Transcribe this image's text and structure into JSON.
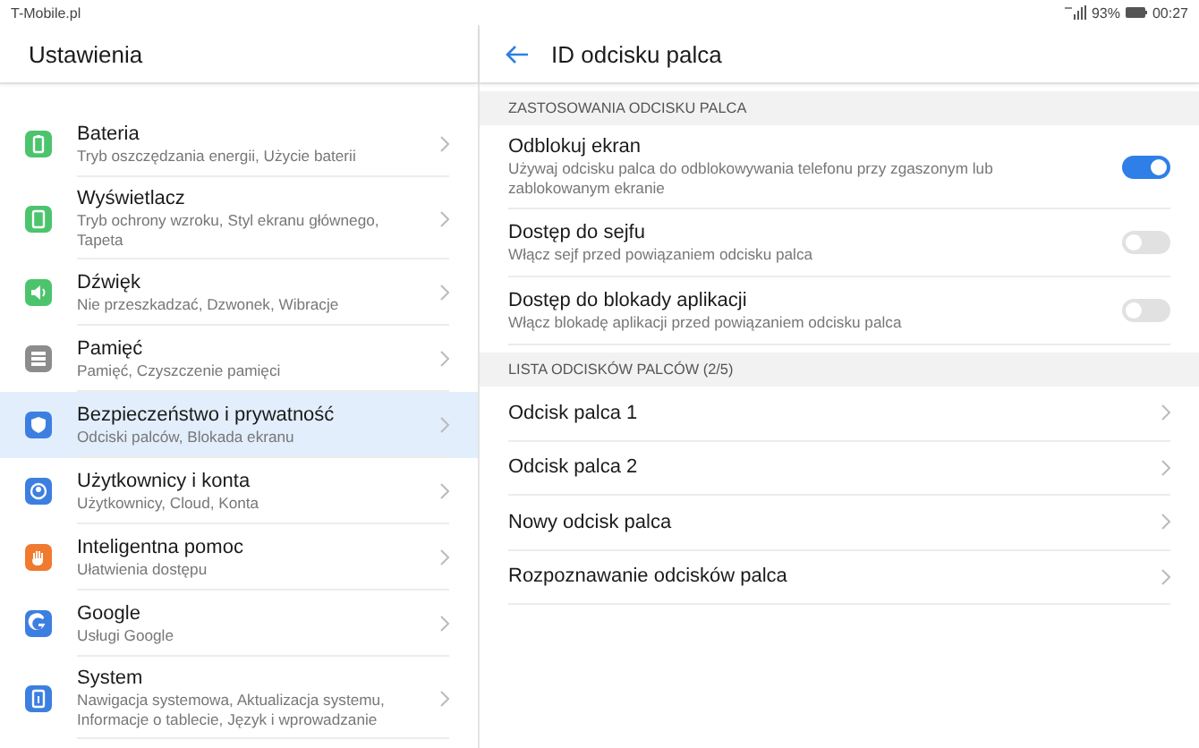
{
  "status_bar": {
    "carrier": "T-Mobile.pl",
    "battery": "93%",
    "time": "00:27"
  },
  "sidebar": {
    "title": "Ustawienia",
    "items": [
      {
        "title": "Bateria",
        "subtitle": "Tryb oszczędzania energii, Użycie baterii",
        "color": "#4cc46c",
        "selected": false
      },
      {
        "title": "Wyświetlacz",
        "subtitle": "Tryb ochrony wzroku, Styl ekranu głównego, Tapeta",
        "color": "#4cc46c",
        "selected": false
      },
      {
        "title": "Dźwięk",
        "subtitle": "Nie przeszkadzać, Dzwonek, Wibracje",
        "color": "#4cc46c",
        "selected": false
      },
      {
        "title": "Pamięć",
        "subtitle": "Pamięć, Czyszczenie pamięci",
        "color": "#8c8c8c",
        "selected": false
      },
      {
        "title": "Bezpieczeństwo i prywatność",
        "subtitle": "Odciski palców, Blokada ekranu",
        "color": "#3d7fe0",
        "selected": true
      },
      {
        "title": "Użytkownicy i konta",
        "subtitle": "Użytkownicy, Cloud, Konta",
        "color": "#3d7fe0",
        "selected": false
      },
      {
        "title": "Inteligentna pomoc",
        "subtitle": "Ułatwienia dostępu",
        "color": "#f07a30",
        "selected": false
      },
      {
        "title": "Google",
        "subtitle": "Usługi Google",
        "color": "#3d7fe0",
        "selected": false
      },
      {
        "title": "System",
        "subtitle": "Nawigacja systemowa, Aktualizacja systemu, Informacje o tablecie, Język i wprowadzanie",
        "color": "#3d7fe0",
        "selected": false
      }
    ]
  },
  "detail": {
    "title": "ID odcisku palca",
    "sections": [
      {
        "header": "ZASTOSOWANIA ODCISKU PALCA",
        "rows": [
          {
            "kind": "toggle",
            "title": "Odblokuj ekran",
            "subtitle": "Używaj odcisku palca do odblokowywania telefonu przy zgaszonym lub zablokowanym ekranie",
            "on": true
          },
          {
            "kind": "toggle",
            "title": "Dostęp do sejfu",
            "subtitle": "Włącz sejf przed powiązaniem odcisku palca",
            "on": false
          },
          {
            "kind": "toggle",
            "title": "Dostęp do blokady aplikacji",
            "subtitle": "Włącz blokadę aplikacji przed powiązaniem odcisku palca",
            "on": false
          }
        ]
      },
      {
        "header": "LISTA ODCISKÓW PALCÓW (2/5)",
        "rows": [
          {
            "kind": "link",
            "title": "Odcisk palca 1"
          },
          {
            "kind": "link",
            "title": "Odcisk palca 2"
          },
          {
            "kind": "link",
            "title": "Nowy odcisk palca"
          },
          {
            "kind": "link",
            "title": "Rozpoznawanie odcisków palca"
          }
        ]
      }
    ]
  }
}
